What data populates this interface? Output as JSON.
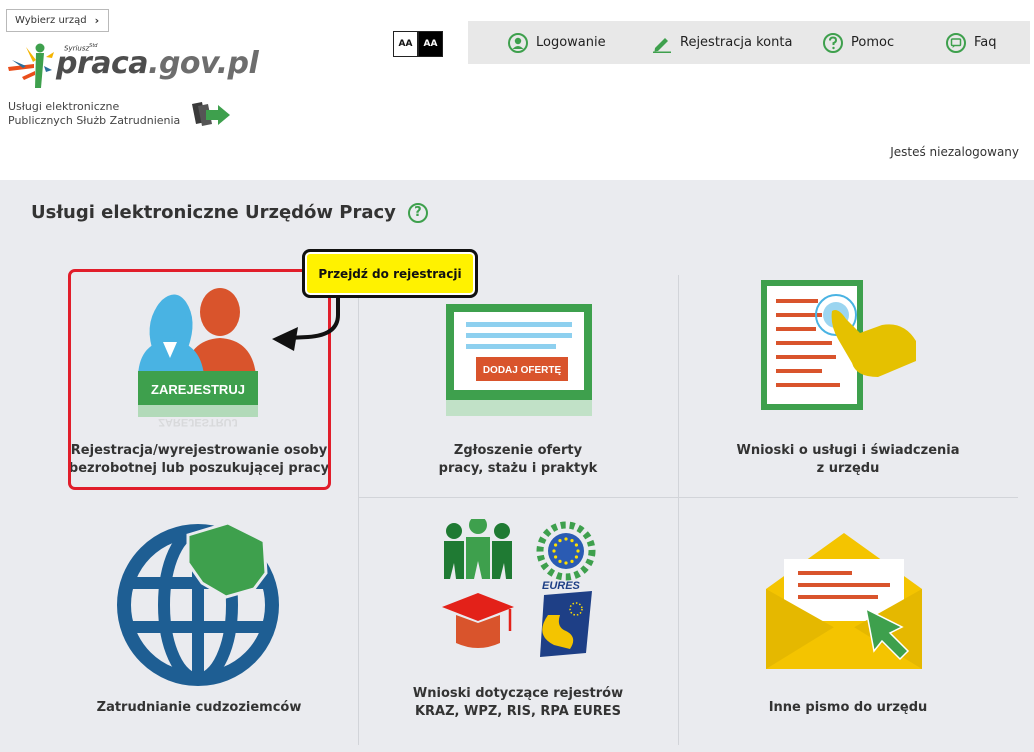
{
  "header": {
    "choose_office": "Wybierz urząd",
    "choose_office_chevron": "›",
    "logo_prefix": "praca",
    "logo_suffix": ".gov.pl",
    "logo_small": "Syriusz",
    "logo_small_sup": "Std",
    "services_line1": "Usługi elektroniczne",
    "services_line2": "Publicznych Służb Zatrudnienia",
    "contrast_light": "AA",
    "contrast_dark": "AA",
    "not_logged": "Jesteś niezalogowany"
  },
  "nav": [
    {
      "label": "Logowanie",
      "icon": "user-icon"
    },
    {
      "label": "Rejestracja konta",
      "icon": "pencil-icon"
    },
    {
      "label": "Pomoc",
      "icon": "help-icon"
    },
    {
      "label": "Faq",
      "icon": "chat-icon"
    }
  ],
  "main": {
    "title": "Usługi elektroniczne Urzędów Pracy",
    "help_symbol": "?",
    "tooltip": "Przejdź do rejestracji",
    "tiles": [
      {
        "line1": "Rejestracja/wyrejestrowanie osoby",
        "line2": "bezrobotnej lub poszukującej pracy",
        "badge": "ZAREJESTRUJ",
        "badge_reflect": "ZAREJESTRUJ"
      },
      {
        "line1": "Zgłoszenie oferty",
        "line2": "pracy, stażu i praktyk",
        "badge": "DODAJ OFERTĘ"
      },
      {
        "line1": "Wnioski o usługi i świadczenia",
        "line2": "z urzędu"
      },
      {
        "line1": "Zatrudnianie cudzoziemców",
        "line2": ""
      },
      {
        "line1": "Wnioski dotyczące rejestrów",
        "line2": "KRAZ, WPZ, RIS, RPA EURES",
        "eures": "EURES"
      },
      {
        "line1": "Inne pismo do urzędu",
        "line2": ""
      }
    ]
  },
  "colors": {
    "green": "#3ea04d",
    "red_highlight": "#e11d2a",
    "tooltip_yellow": "#fff200",
    "nav_bg": "#e8e8e8",
    "main_bg": "#eaebef"
  }
}
